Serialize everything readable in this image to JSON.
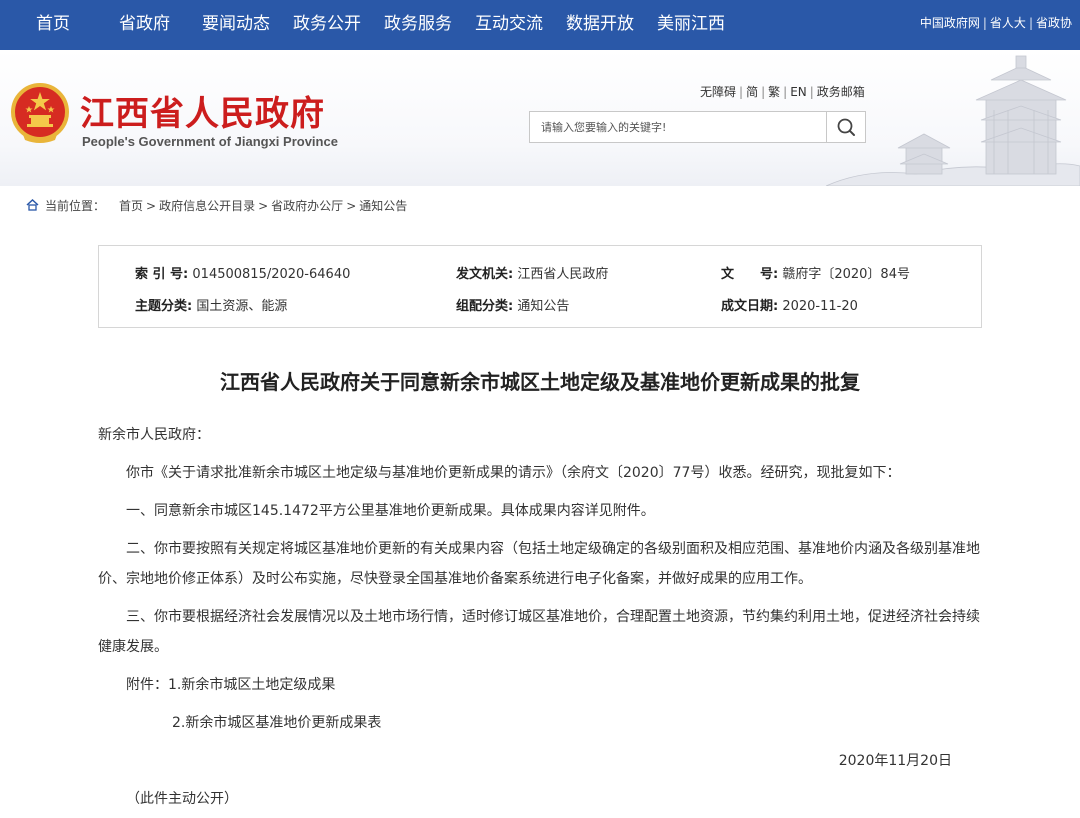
{
  "topnav": {
    "items": [
      "首页",
      "省政府",
      "要闻动态",
      "政务公开",
      "政务服务",
      "互动交流",
      "数据开放",
      "美丽江西"
    ],
    "right_links": [
      "中国政府网",
      "省人大",
      "省政协"
    ]
  },
  "header": {
    "title": "江西省人民政府",
    "subtitle": "People's Government of Jiangxi Province",
    "util_links": [
      "无障碍",
      "简",
      "繁",
      "EN",
      "政务邮箱"
    ],
    "search_placeholder": "请输入您要输入的关键字!"
  },
  "breadcrumb": {
    "label": "当前位置：",
    "items": [
      "首页",
      "政府信息公开目录",
      "省政府办公厅",
      "通知公告"
    ]
  },
  "meta": {
    "index_label": "索 引 号:",
    "index_value": "014500815/2020-64640",
    "issuer_label": "发文机关:",
    "issuer_value": "江西省人民政府",
    "docno_label": "文　　号:",
    "docno_value": "赣府字〔2020〕84号",
    "topic_label": "主题分类:",
    "topic_value": "国土资源、能源",
    "category_label": "组配分类:",
    "category_value": "通知公告",
    "date_label": "成文日期:",
    "date_value": "2020-11-20"
  },
  "article": {
    "title": "江西省人民政府关于同意新余市城区土地定级及基准地价更新成果的批复",
    "salutation": "新余市人民政府：",
    "p1": "你市《关于请求批准新余市城区土地定级与基准地价更新成果的请示》（余府文〔2020〕77号）收悉。经研究，现批复如下：",
    "p2": "一、同意新余市城区145.1472平方公里基准地价更新成果。具体成果内容详见附件。",
    "p3": "二、你市要按照有关规定将城区基准地价更新的有关成果内容（包括土地定级确定的各级别面积及相应范围、基准地价内涵及各级别基准地价、宗地地价修正体系）及时公布实施，尽快登录全国基准地价备案系统进行电子化备案，并做好成果的应用工作。",
    "p4": "三、你市要根据经济社会发展情况以及土地市场行情，适时修订城区基准地价，合理配置土地资源，节约集约利用土地，促进经济社会持续健康发展。",
    "attach1": "附件：1.新余市城区土地定级成果",
    "attach2": "2.新余市城区基准地价更新成果表",
    "date": "2020年11月20日",
    "footer": "（此件主动公开）"
  },
  "colors": {
    "nav_bg": "#2a58a8",
    "title_red": "#cc1d1d"
  },
  "icons": {
    "search": "magnifier-icon",
    "home": "home-icon",
    "emblem": "national-emblem-icon"
  }
}
